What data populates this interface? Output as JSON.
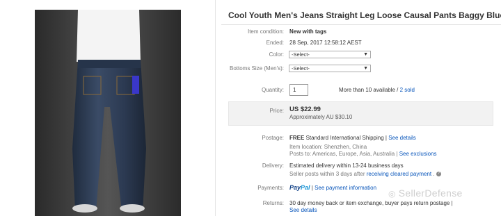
{
  "listing": {
    "title": "Cool Youth Men's Jeans Straight Leg Loose Causal Pants Baggy Blue Denim"
  },
  "fields": {
    "condition_label": "Item condition:",
    "condition_value": "New with tags",
    "ended_label": "Ended:",
    "ended_value": "28 Sep, 2017  12:58:12 AEST",
    "color_label": "Color:",
    "color_value": "-Select-",
    "size_label": "Bottoms Size (Men's):",
    "size_value": "-Select-",
    "quantity_label": "Quantity:",
    "quantity_value": "1",
    "availability": "More than 10 available /",
    "sold_link": "2 sold"
  },
  "price": {
    "label": "Price:",
    "value": "US $22.99",
    "approx": "Approximately AU $30.10"
  },
  "postage": {
    "label": "Postage:",
    "free": "FREE",
    "service": "Standard International Shipping |",
    "details_link": "See details",
    "location": "Item location: Shenzhen, China",
    "posts_to": "Posts to: Americas, Europe, Asia, Australia |",
    "exclusions_link": "See exclusions"
  },
  "delivery": {
    "label": "Delivery:",
    "estimate": "Estimated delivery within 13-24 business days",
    "seller_posts": "Seller posts within 3 days after",
    "cleared_link": "receiving cleared payment",
    "suffix": ".",
    "help_icon": "?"
  },
  "payments": {
    "label": "Payments:",
    "paypal_a": "Pay",
    "paypal_b": "Pal",
    "sep": "|",
    "info_link": "See payment information"
  },
  "returns": {
    "label": "Returns:",
    "text": "30 day money back or item exchange, buyer pays return postage |",
    "details_link": "See details"
  },
  "watermark": {
    "text": "SellerDefense",
    "icon": "wechat-icon"
  },
  "colors": {
    "link": "#0654ba",
    "price_box": "#f2f2f2",
    "paypal_dark": "#0f3f86",
    "paypal_light": "#1c96d6"
  }
}
